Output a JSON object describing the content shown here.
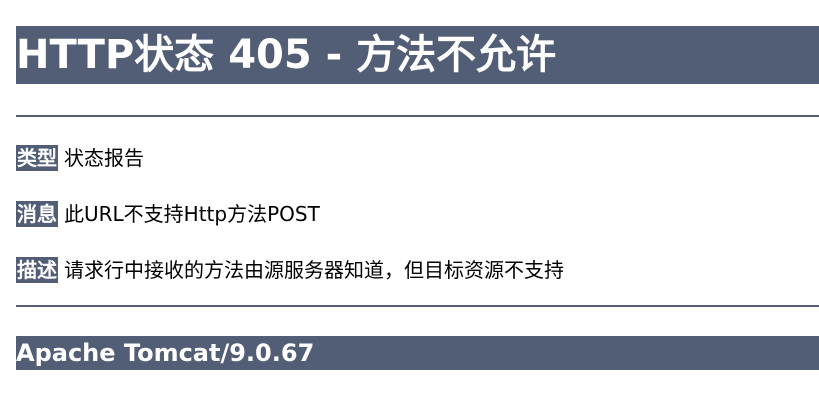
{
  "page": {
    "title": "HTTP状态 405 - 方法不允许",
    "rows": [
      {
        "label": "类型",
        "value": "状态报告"
      },
      {
        "label": "消息",
        "value": "此URL不支持Http方法POST"
      },
      {
        "label": "描述",
        "value": "请求行中接收的方法由源服务器知道，但目标资源不支持"
      }
    ],
    "footer": "Apache Tomcat/9.0.67"
  },
  "colors": {
    "banner_background": "#525d76",
    "banner_text": "#ffffff",
    "body_text": "#000000"
  }
}
